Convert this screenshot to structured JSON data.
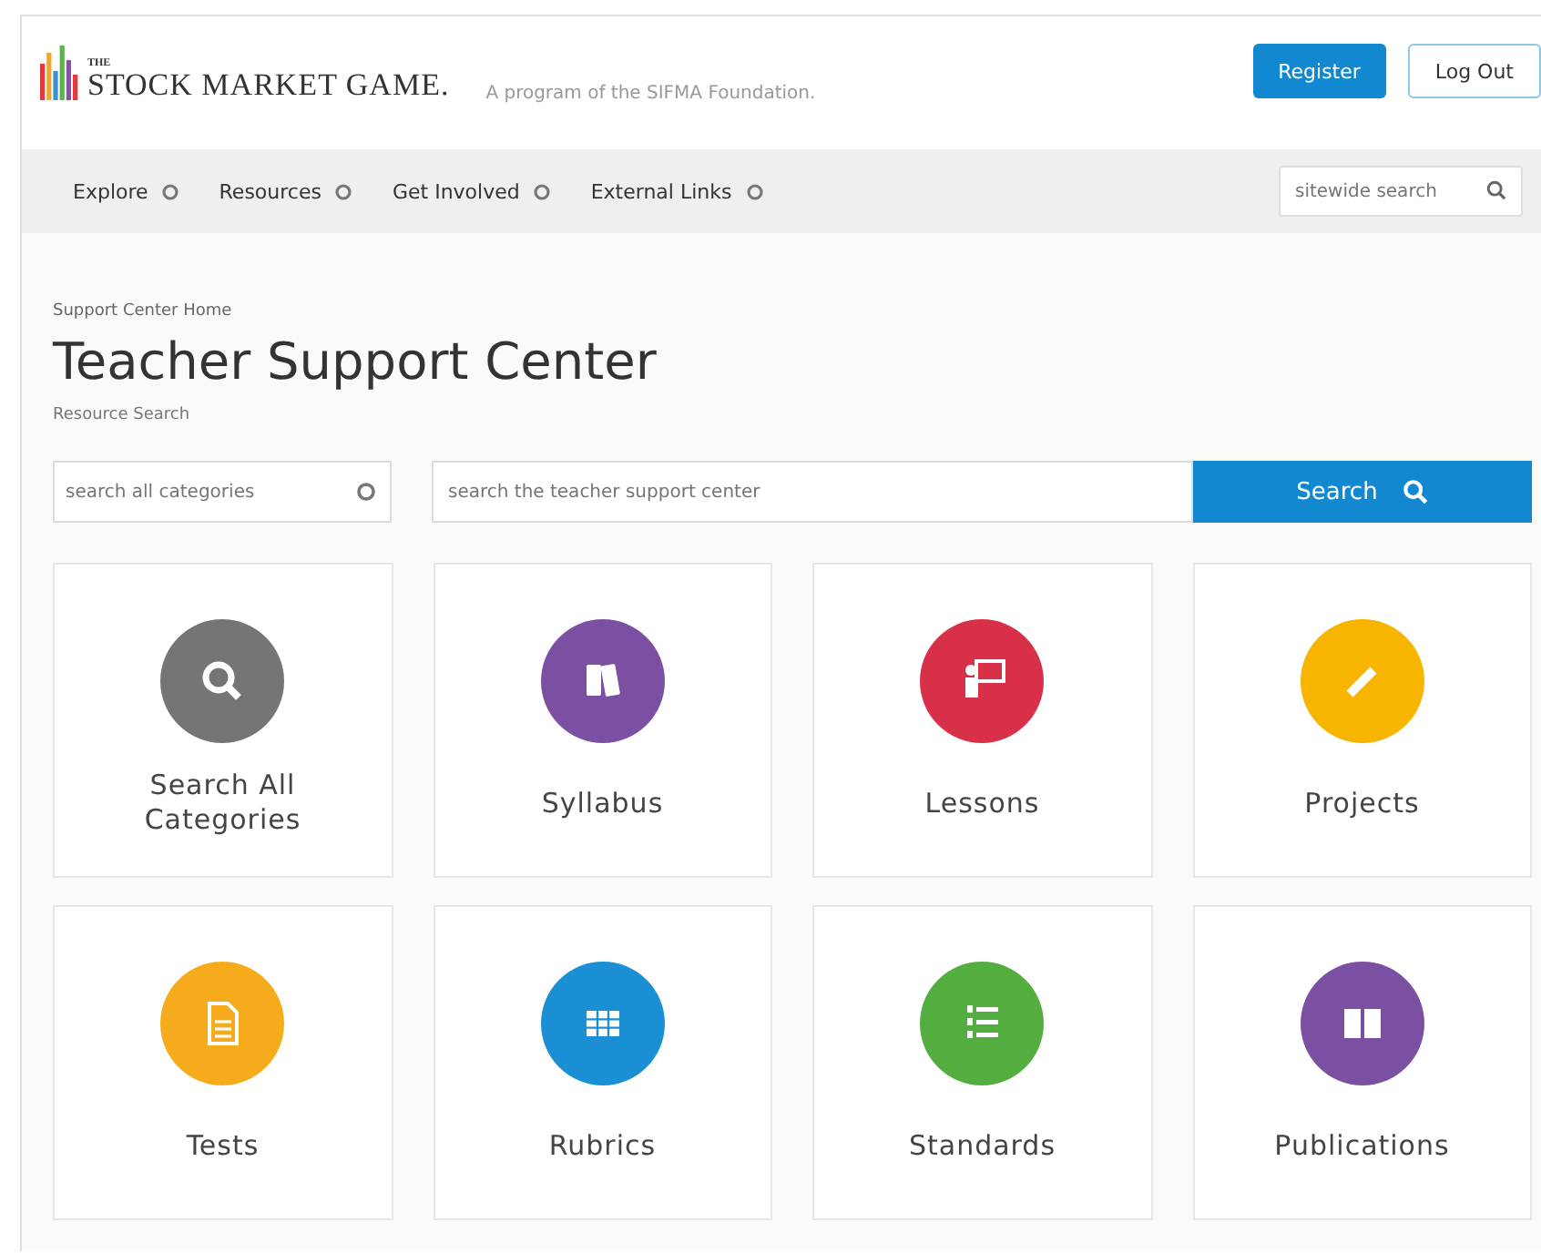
{
  "header": {
    "logo_small": "THE",
    "logo": "STOCK MARKET GAME.",
    "tagline": "A program of the SIFMA Foundation.",
    "buttons": [
      {
        "label": "Register",
        "kind": "primary"
      },
      {
        "label": "Log Out",
        "kind": "outline"
      }
    ]
  },
  "nav": {
    "items": [
      "Explore",
      "Resources",
      "Get Involved",
      "External Links"
    ],
    "search": {
      "placeholder": "sitewide search"
    }
  },
  "breadcrumb": "Support Center Home",
  "title": "Teacher Support Center",
  "subtitle": "Resource Search",
  "search": {
    "category_placeholder": "search all categories",
    "placeholder": "search the teacher support center",
    "button": "Search"
  },
  "categories": [
    {
      "label": "Search All Categories",
      "kind": "search",
      "color": "#757575"
    },
    {
      "label": "Syllabus",
      "kind": "books",
      "color": "#7b4fa1"
    },
    {
      "label": "Lessons",
      "kind": "presenter",
      "color": "#d9304a"
    },
    {
      "label": "Projects",
      "kind": "pencil",
      "color": "#f7b500"
    },
    {
      "label": "Tests",
      "kind": "document",
      "color": "#f5ab1c"
    },
    {
      "label": "Rubrics",
      "kind": "table",
      "color": "#1a8fd4"
    },
    {
      "label": "Standards",
      "kind": "list",
      "color": "#53ad3f"
    },
    {
      "label": "Publications",
      "kind": "book",
      "color": "#7b4fa1"
    }
  ]
}
